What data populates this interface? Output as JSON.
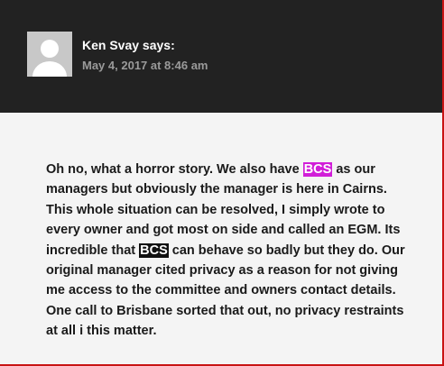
{
  "comment": {
    "author_line": "Ken Svay says:",
    "date": "May 4, 2017 at 8:46 am",
    "body": {
      "p1": "Oh no, what a horror story. We also have ",
      "highlight1": "BCS",
      "p2": " as our managers but obviously the manager is here in Cairns. This whole situation can be resolved, I simply wrote to every owner and got most on side and called an EGM. Its incredible that ",
      "highlight2": "BCS",
      "p3": " can behave so badly but they do. Our original manager cited privacy as a reason for not giving me access to the committee and owners contact details. One call to Brisbane sorted that out, no privacy restraints at all i this matter."
    },
    "avatar_icon": "default-user-avatar-icon",
    "colors": {
      "header_bg": "#222222",
      "body_bg": "#f4f4f4",
      "highlight_magenta": "#d11ed8",
      "highlight_black": "#111111",
      "frame_border": "#c81414"
    }
  }
}
